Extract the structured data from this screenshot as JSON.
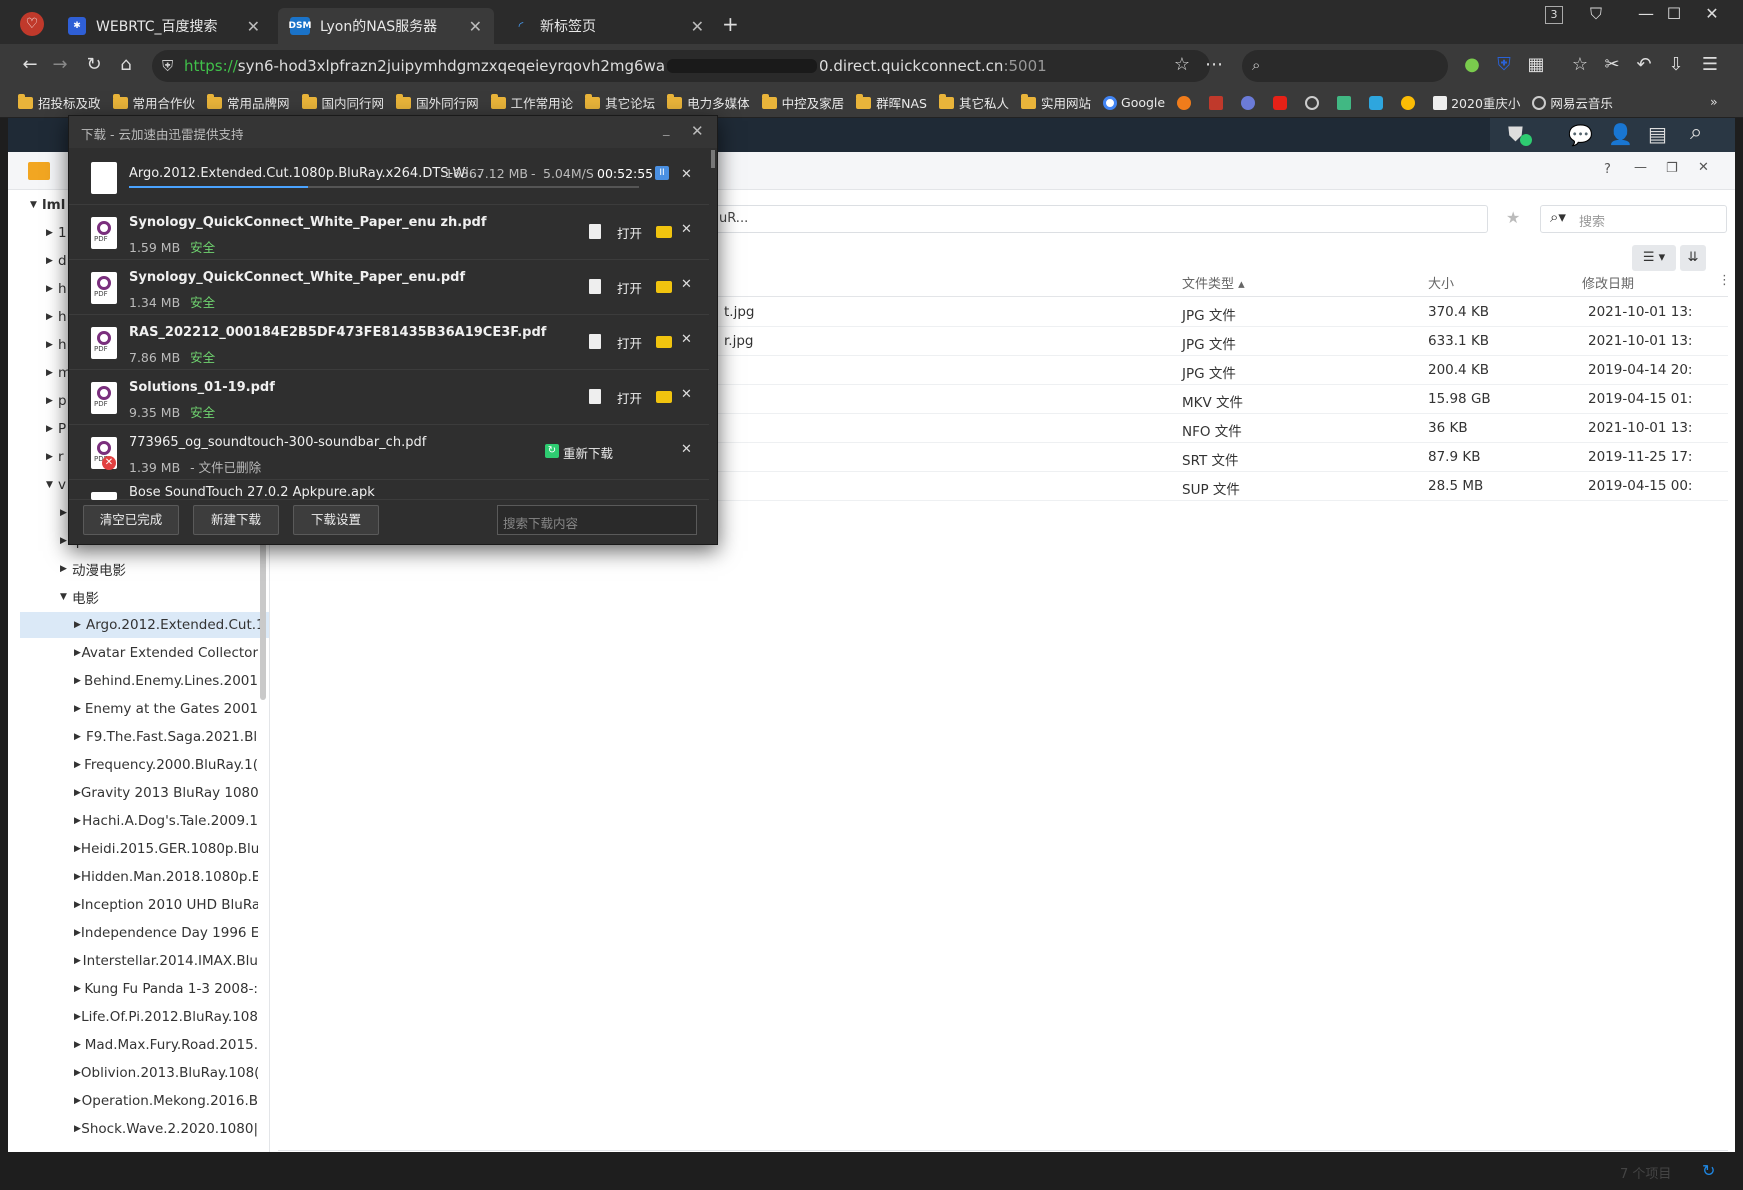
{
  "browser": {
    "tabs": [
      {
        "title": "WEBRTC_百度搜索"
      },
      {
        "title": "Lyon的NAS服务器",
        "favicon": "DSM"
      },
      {
        "title": "新标签页"
      }
    ],
    "tab_count_badge": "3",
    "url_prefix": "https://",
    "url_part1": "syn6-hod3xlpfrazn2juipymhdgmzxqeqeieyrqovh2mg6wa",
    "url_part2": "0.direct.quickconnect.cn",
    "url_port": ":5001",
    "bookmarks": [
      "招投标及政",
      "常用合作伙",
      "常用品牌网",
      "国内同行网",
      "国外同行网",
      "工作常用论",
      "其它论坛",
      "电力多媒体",
      "中控及家居",
      "群晖NAS",
      "其它私人",
      "实用网站",
      "Google",
      "2020重庆小",
      "网易云音乐"
    ]
  },
  "download_panel": {
    "title": "下载 - 云加速由迅雷提供支持",
    "items": [
      {
        "name": "Argo.2012.Extended.Cut.1080p.BluRay.x264.DTS-Wi...",
        "size": "16367.12 MB",
        "speed": "5.04M/S",
        "remaining": "00:52:55"
      },
      {
        "name": "Synology_QuickConnect_White_Paper_enu zh.pdf",
        "size": "1.59 MB",
        "status": "安全",
        "open": "打开"
      },
      {
        "name": "Synology_QuickConnect_White_Paper_enu.pdf",
        "size": "1.34 MB",
        "status": "安全",
        "open": "打开"
      },
      {
        "name": "RAS_202212_000184E2B5DF473FE81435B36A19CE3F.pdf",
        "size": "7.86 MB",
        "status": "安全",
        "open": "打开"
      },
      {
        "name": "Solutions_01-19.pdf",
        "size": "9.35 MB",
        "status": "安全",
        "open": "打开"
      },
      {
        "name": "773965_og_soundtouch-300-soundbar_ch.pdf",
        "size": "1.39 MB",
        "status": "- 文件已删除",
        "redownload": "重新下载"
      },
      {
        "name": "Bose SoundTouch 27.0.2 Apkpure.apk"
      }
    ],
    "buttons": {
      "clear": "清空已完成",
      "new": "新建下载",
      "settings": "下载设置"
    },
    "search_placeholder": "搜索下载内容"
  },
  "file_station": {
    "path_fragment": "uR...",
    "search_placeholder": "搜索",
    "columns": {
      "type": "文件类型 ▴",
      "size": "大小",
      "modified": "修改日期"
    },
    "rows": [
      {
        "name_fragment": "t.jpg",
        "type": "JPG 文件",
        "size": "370.4 KB",
        "date": "2021-10-01 13:"
      },
      {
        "name_fragment": "r.jpg",
        "type": "JPG 文件",
        "size": "633.1 KB",
        "date": "2021-10-01 13:"
      },
      {
        "name_fragment": "",
        "type": "JPG 文件",
        "size": "200.4 KB",
        "date": "2019-04-14 20:"
      },
      {
        "name_fragment": "",
        "type": "MKV 文件",
        "size": "15.98 GB",
        "date": "2019-04-15 01:"
      },
      {
        "name_fragment": "",
        "type": "NFO 文件",
        "size": "36 KB",
        "date": "2021-10-01 13:"
      },
      {
        "name_fragment": "",
        "type": "SRT 文件",
        "size": "87.9 KB",
        "date": "2019-11-25 17:"
      },
      {
        "name_fragment": "",
        "type": "SUP 文件",
        "size": "28.5 MB",
        "date": "2019-04-15 00:"
      }
    ],
    "item_count": "7 个项目",
    "tree": [
      {
        "label": "lml",
        "level": 0,
        "open": true
      },
      {
        "label": "1",
        "level": 1
      },
      {
        "label": "d",
        "level": 1
      },
      {
        "label": "h",
        "level": 1
      },
      {
        "label": "h",
        "level": 1
      },
      {
        "label": "h",
        "level": 1
      },
      {
        "label": "m",
        "level": 1
      },
      {
        "label": "p",
        "level": 1
      },
      {
        "label": "P",
        "level": 1
      },
      {
        "label": "r",
        "level": 1
      },
      {
        "label": "v",
        "level": 1,
        "open": true
      },
      {
        "label": "",
        "level": 2
      },
      {
        "label": "iptv",
        "level": 2
      },
      {
        "label": "动漫电影",
        "level": 2
      },
      {
        "label": "电影",
        "level": 2,
        "open": true
      },
      {
        "label": "Argo.2012.Extended.Cut.1",
        "level": 3,
        "selected": true
      },
      {
        "label": "Avatar Extended Collector",
        "level": 3
      },
      {
        "label": "Behind.Enemy.Lines.2001",
        "level": 3
      },
      {
        "label": "Enemy at the Gates 2001",
        "level": 3
      },
      {
        "label": "F9.The.Fast.Saga.2021.Bl",
        "level": 3
      },
      {
        "label": "Frequency.2000.BluRay.1(",
        "level": 3
      },
      {
        "label": "Gravity 2013 BluRay 1080",
        "level": 3
      },
      {
        "label": "Hachi.A.Dog's.Tale.2009.1",
        "level": 3
      },
      {
        "label": "Heidi.2015.GER.1080p.Blu",
        "level": 3
      },
      {
        "label": "Hidden.Man.2018.1080p.E",
        "level": 3
      },
      {
        "label": "Inception 2010 UHD BluRa",
        "level": 3
      },
      {
        "label": "Independence Day 1996 E",
        "level": 3
      },
      {
        "label": "Interstellar.2014.IMAX.Blu",
        "level": 3
      },
      {
        "label": "Kung Fu Panda 1-3 2008-:",
        "level": 3
      },
      {
        "label": "Life.Of.Pi.2012.BluRay.108",
        "level": 3
      },
      {
        "label": "Mad.Max.Fury.Road.2015.",
        "level": 3
      },
      {
        "label": "Oblivion.2013.BluRay.108(",
        "level": 3
      },
      {
        "label": "Operation.Mekong.2016.B",
        "level": 3
      },
      {
        "label": "Shock.Wave.2.2020.1080|",
        "level": 3
      }
    ]
  }
}
